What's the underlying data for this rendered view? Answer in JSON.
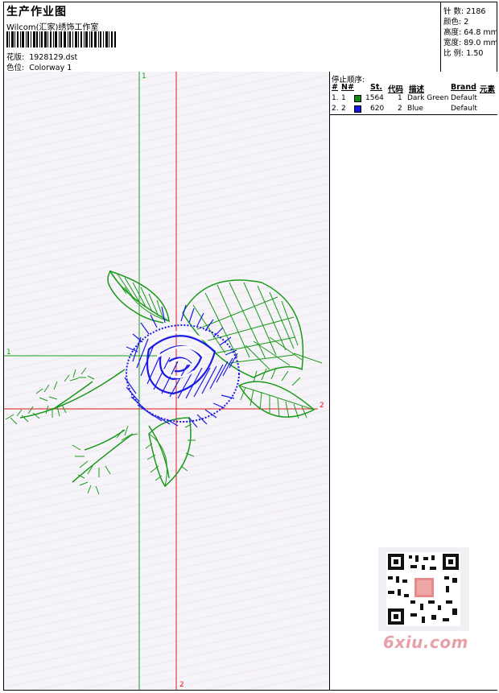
{
  "header": {
    "title": "生产作业图",
    "subtitle": "Wilcom(汇家)绣饰工作室",
    "design_label": "花版:",
    "design_value": "1928129.dst",
    "colorway_label": "色位:",
    "colorway_value": "Colorway 1"
  },
  "stats": [
    {
      "label": "针 数:",
      "value": "2186"
    },
    {
      "label": "颜色:",
      "value": "2"
    },
    {
      "label": "高度:",
      "value": "64.8 mm"
    },
    {
      "label": "宽度:",
      "value": "89.0 mm"
    },
    {
      "label": "比 例:",
      "value": "1.50"
    }
  ],
  "stop_sequence": {
    "title": "停止顺序:",
    "headers": {
      "hash": "#",
      "no": "N#",
      "st": "St.",
      "code": "代码",
      "desc": "描述",
      "brand": "Brand",
      "elem": "元素"
    },
    "rows": [
      {
        "idx": "1.",
        "num": "1",
        "st": "1564",
        "code": "1",
        "desc": "Dark Green",
        "brand": "Default",
        "color": "#138a13"
      },
      {
        "idx": "2.",
        "num": "2",
        "st": "620",
        "code": "2",
        "desc": "Blue",
        "brand": "Default",
        "color": "#1414e0"
      }
    ]
  },
  "guides": {
    "green_top": "1",
    "green_left": "1",
    "red_right": "2",
    "red_bottom": "2"
  },
  "colors": {
    "green": "#1aa01a",
    "red": "#e01818",
    "blue": "#1a1ae6"
  },
  "watermark": "6xiu.com"
}
